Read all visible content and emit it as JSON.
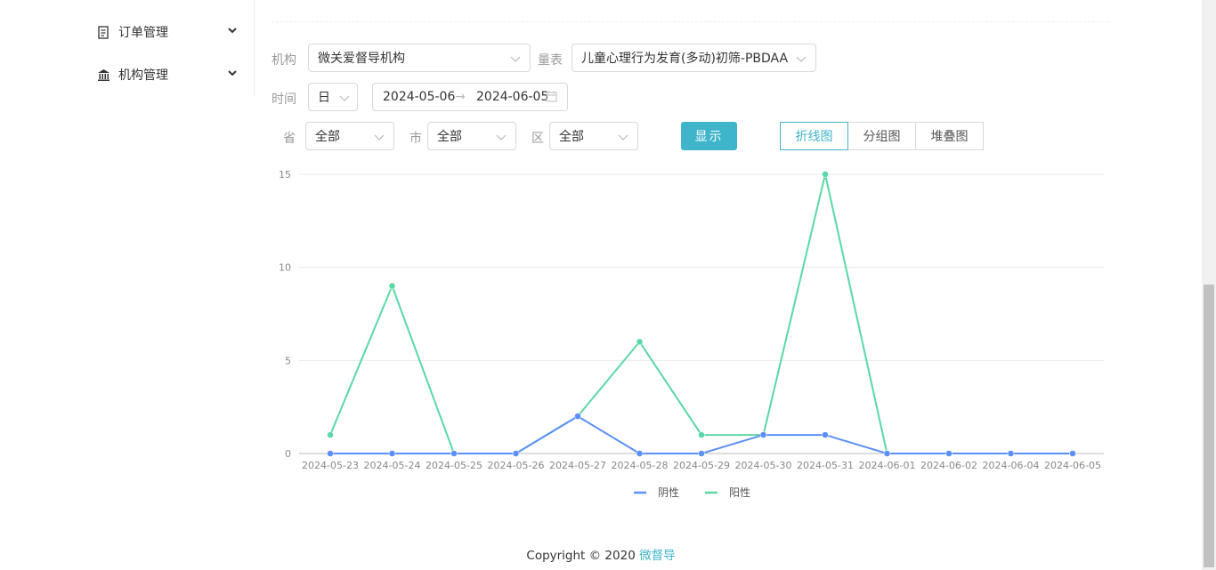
{
  "sidebar": {
    "items": [
      {
        "label": "订单管理",
        "icon": "clipboard-icon"
      },
      {
        "label": "机构管理",
        "icon": "bank-icon"
      }
    ]
  },
  "filters": {
    "org_label": "机构",
    "org_value": "微关爱督导机构",
    "scale_label": "量表",
    "scale_value": "儿童心理行为发育(多动)初筛-PBDAA",
    "time_label": "时间",
    "time_unit": "日",
    "date_start": "2024-05-06",
    "date_end": "2024-06-05",
    "date_sep": "→",
    "province_label": "省",
    "province_value": "全部",
    "city_label": "市",
    "city_value": "全部",
    "district_label": "区",
    "district_value": "全部",
    "show_button": "显示"
  },
  "view_tabs": [
    {
      "label": "折线图",
      "active": true
    },
    {
      "label": "分组图",
      "active": false
    },
    {
      "label": "堆叠图",
      "active": false
    }
  ],
  "colors": {
    "accent": "#3fb5cb",
    "negative": "#5b8ff9",
    "positive": "#5ad8a6"
  },
  "chart_data": {
    "type": "line",
    "categories": [
      "2024-05-23",
      "2024-05-24",
      "2024-05-25",
      "2024-05-26",
      "2024-05-27",
      "2024-05-28",
      "2024-05-29",
      "2024-05-30",
      "2024-05-31",
      "2024-06-01",
      "2024-06-02",
      "2024-06-04",
      "2024-06-05"
    ],
    "series": [
      {
        "name": "阴性",
        "values": [
          0,
          0,
          0,
          0,
          2,
          0,
          0,
          1,
          1,
          0,
          0,
          0,
          0
        ]
      },
      {
        "name": "阳性",
        "values": [
          1,
          9,
          0,
          0,
          2,
          6,
          1,
          1,
          15,
          0,
          0,
          0,
          0
        ]
      }
    ],
    "yticks": [
      0,
      5,
      10,
      15
    ],
    "ylim": [
      0,
      15
    ],
    "grid": true,
    "legend_position": "bottom"
  },
  "footer": {
    "text": "Copyright © 2020",
    "link": "微督导"
  }
}
